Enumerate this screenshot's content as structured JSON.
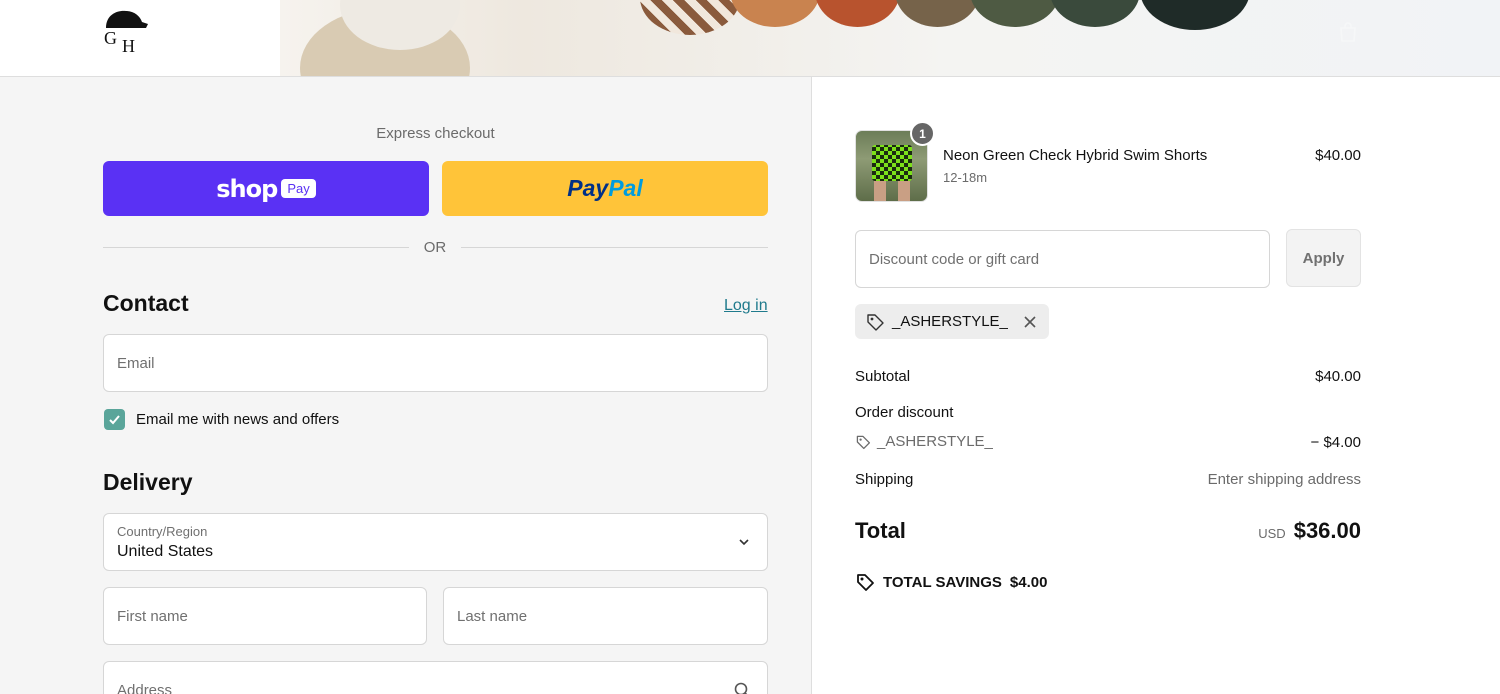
{
  "header": {
    "logo_alt_text": "GH",
    "logo_icon": "cap-logo-icon",
    "cart_icon": "shopping-bag-icon"
  },
  "express": {
    "title": "Express checkout",
    "shop_pay": {
      "word": "shop",
      "badge": "Pay",
      "color": "#5a31f4"
    },
    "paypal": {
      "part1": "Pay",
      "part2": "Pal",
      "color": "#ffc439"
    },
    "or_label": "OR"
  },
  "contact": {
    "title": "Contact",
    "login_link": "Log in",
    "email_placeholder": "Email",
    "newsletter_checked": true,
    "newsletter_label": "Email me with news and offers"
  },
  "delivery": {
    "title": "Delivery",
    "country_label": "Country/Region",
    "country_value": "United States",
    "first_name_placeholder": "First name",
    "last_name_placeholder": "Last name",
    "address_placeholder": "Address"
  },
  "order": {
    "item": {
      "quantity": "1",
      "name": "Neon Green Check Hybrid Swim Shorts",
      "variant": "12-18m",
      "price": "$40.00"
    },
    "discount_placeholder": "Discount code or gift card",
    "apply_label": "Apply",
    "applied_code": "_ASHERSTYLE_",
    "subtotal_label": "Subtotal",
    "subtotal_value": "$40.00",
    "order_discount_label": "Order discount",
    "discount_code_label": "_ASHERSTYLE_",
    "discount_value": "− $4.00",
    "shipping_label": "Shipping",
    "shipping_value": "Enter shipping address",
    "total_label": "Total",
    "total_currency": "USD",
    "total_value": "$36.00",
    "savings_label": "TOTAL SAVINGS",
    "savings_value": "$4.00"
  },
  "colors": {
    "accent_link": "#1f7a8c",
    "checkbox": "#5aa59a",
    "left_bg": "#f5f5f5"
  }
}
